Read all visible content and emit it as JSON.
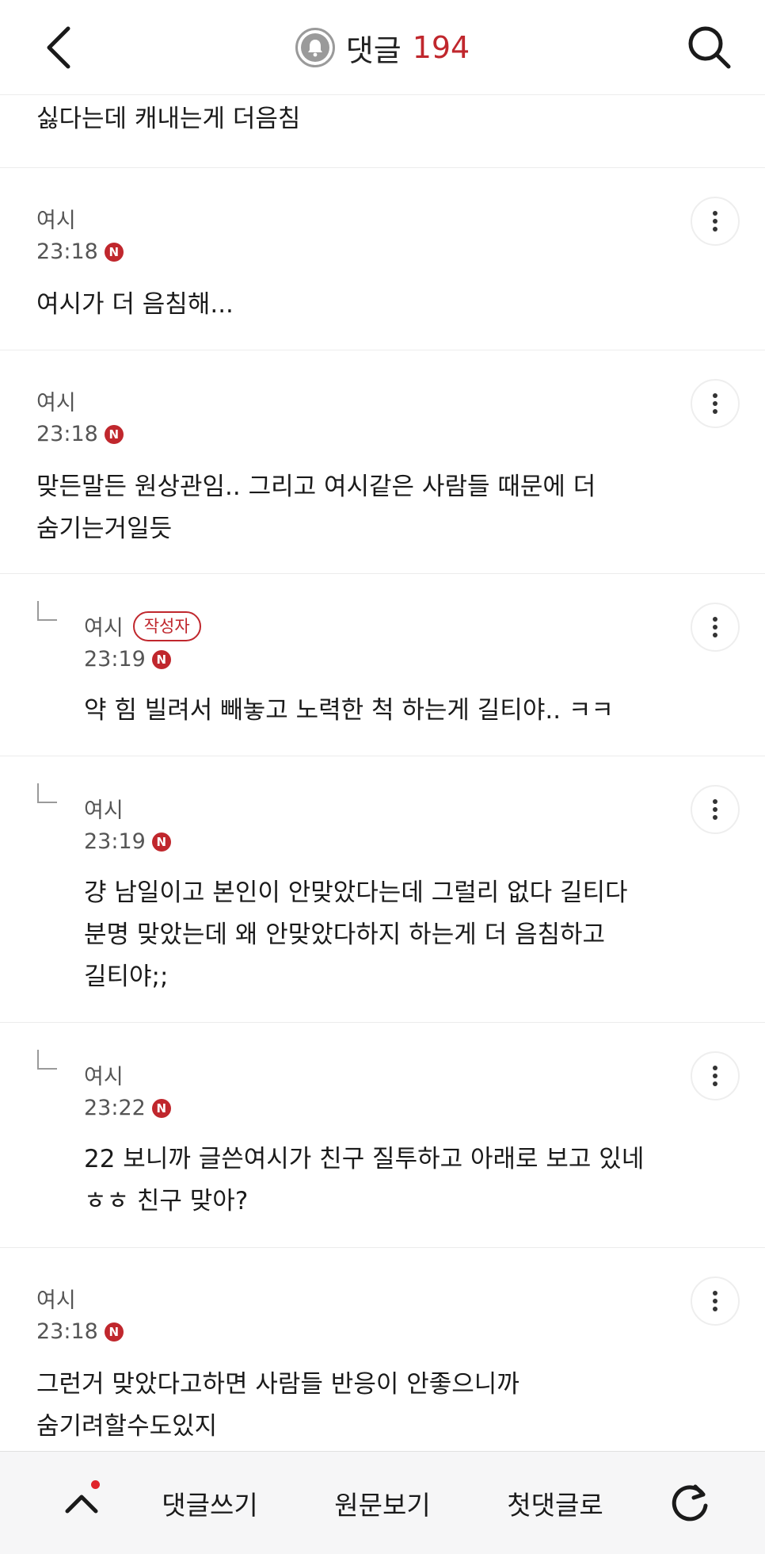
{
  "header": {
    "title": "댓글",
    "count": "194"
  },
  "partial": {
    "text": "싫다는데 캐내는게 더음침"
  },
  "comments": [
    {
      "author": "여시",
      "badge": "",
      "time": "23:18",
      "new_label": "N",
      "text": "여시가 더 음침해..."
    },
    {
      "author": "여시",
      "badge": "",
      "time": "23:18",
      "new_label": "N",
      "text": "맞든말든 원상관임.. 그리고 여시같은 사람들 때문에 더\n숨기는거일듯"
    },
    {
      "author": "여시",
      "badge": "작성자",
      "time": "23:19",
      "new_label": "N",
      "text": "약 힘 빌려서 빼놓고 노력한 척 하는게 길티야.. ㅋㅋ"
    },
    {
      "author": "여시",
      "badge": "",
      "time": "23:19",
      "new_label": "N",
      "text": "걍 남일이고 본인이 안맞았다는데 그럴리 없다 길티다\n분명 맞았는데 왜 안맞았다하지 하는게 더 음침하고\n길티야;;"
    },
    {
      "author": "여시",
      "badge": "",
      "time": "23:22",
      "new_label": "N",
      "text": "22 보니까 글쓴여시가 친구 질투하고 아래로 보고 있네\nㅎㅎ 친구 맞아?"
    },
    {
      "author": "여시",
      "badge": "",
      "time": "23:18",
      "new_label": "N",
      "text": "그런거 맞았다고하면 사람들 반응이 안좋으니까\n숨기려할수도있지"
    }
  ],
  "bottom_bar": {
    "write_label": "댓글쓰기",
    "original_label": "원문보기",
    "first_label": "첫댓글로"
  },
  "colors": {
    "accent": "#c0272d",
    "notification_dot": "#e0242b"
  },
  "icons": {
    "back": "back-arrow-icon",
    "bell": "bell-icon",
    "search": "search-icon",
    "more": "more-vertical-icon",
    "reply": "reply-arrow-icon",
    "up": "chevron-up-icon",
    "refresh": "refresh-icon",
    "new": "new-badge-icon"
  }
}
